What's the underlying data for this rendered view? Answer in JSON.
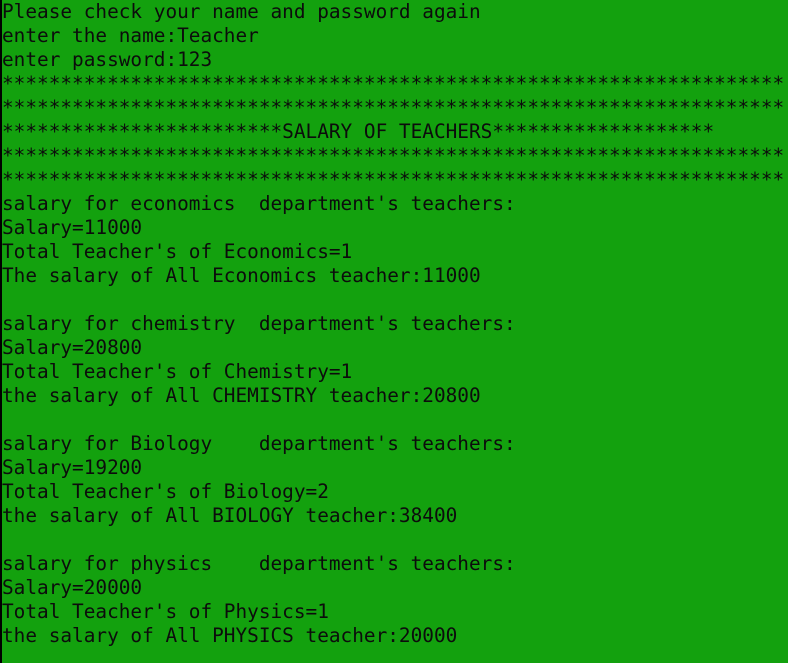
{
  "console": {
    "background_color": "#13a10e",
    "text_color": "#0c0c0c",
    "login": {
      "error_message": "Please check your name and password again",
      "name_prompt": "enter the name:Teacher",
      "password_prompt": "enter password:123"
    },
    "banner": {
      "stars_1": "*******************************************************************",
      "stars_2": "*******************************************************************",
      "title_line": "************************SALARY OF TEACHERS*******************",
      "stars_3": "*******************************************************************",
      "stars_4": "*******************************************************************"
    },
    "departments": [
      {
        "header": "salary for economics  department's teachers:",
        "salary": "Salary=11000",
        "total": "Total Teacher's of Economics=1",
        "all_salary": "The salary of All Economics teacher:11000"
      },
      {
        "header": "salary for chemistry  department's teachers:",
        "salary": "Salary=20800",
        "total": "Total Teacher's of Chemistry=1",
        "all_salary": "the salary of All CHEMISTRY teacher:20800"
      },
      {
        "header": "salary for Biology    department's teachers:",
        "salary": "Salary=19200",
        "total": "Total Teacher's of Biology=2",
        "all_salary": "the salary of All BIOLOGY teacher:38400"
      },
      {
        "header": "salary for physics    department's teachers:",
        "salary": "Salary=20000",
        "total": "Total Teacher's of Physics=1",
        "all_salary": "the salary of All PHYSICS teacher:20000"
      }
    ]
  }
}
